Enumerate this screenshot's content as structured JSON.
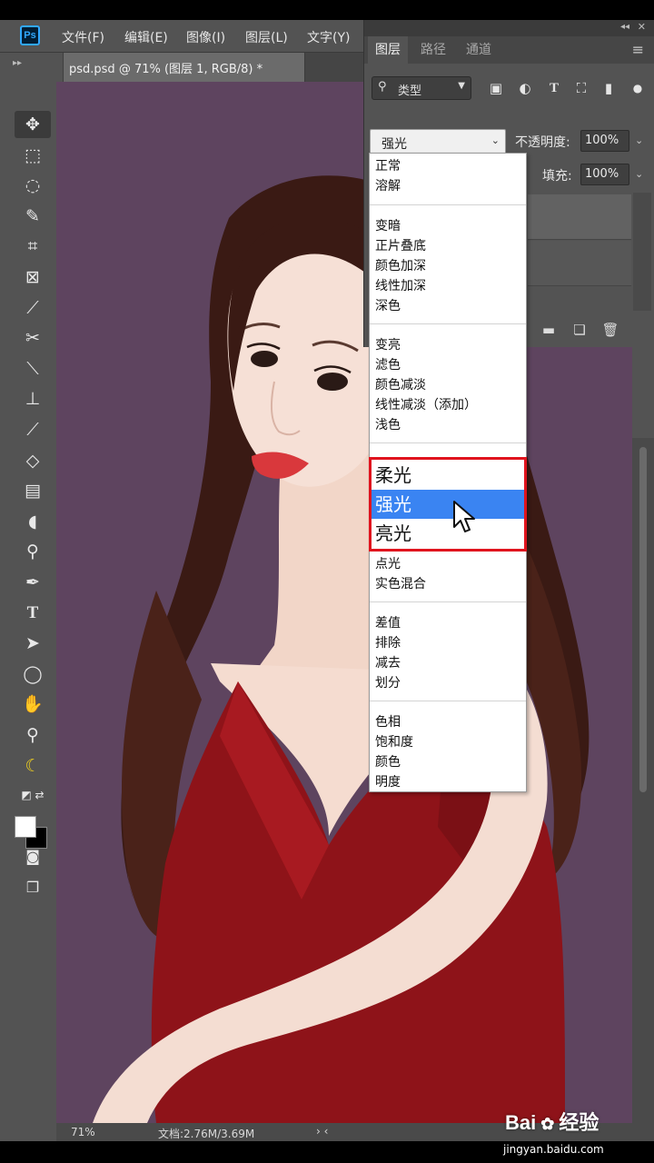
{
  "menubar": {
    "app_logo": "Ps",
    "items": [
      "文件(F)",
      "编辑(E)",
      "图像(I)",
      "图层(L)",
      "文字(Y)"
    ]
  },
  "document": {
    "tab_title": "psd.psd @ 71% (图层 1, RGB/8) *"
  },
  "status": {
    "zoom": "71%",
    "doc_size": "文档:2.76M/3.69M"
  },
  "layers_panel": {
    "tabs": [
      "图层",
      "路径",
      "通道"
    ],
    "filter_label": "类型",
    "blend_mode": "强光",
    "opacity_label": "不透明度:",
    "opacity_value": "100%",
    "fill_label": "填充:",
    "fill_value": "100%"
  },
  "blend_menu": {
    "groups": [
      [
        "正常",
        "溶解"
      ],
      [
        "变暗",
        "正片叠底",
        "颜色加深",
        "线性加深",
        "深色"
      ],
      [
        "变亮",
        "滤色",
        "颜色减淡",
        "线性减淡（添加）",
        "浅色"
      ],
      [
        "柔光",
        "强光",
        "亮光"
      ],
      [
        "点光",
        "实色混合"
      ],
      [
        "差值",
        "排除",
        "减去",
        "划分"
      ],
      [
        "色相",
        "饱和度",
        "颜色",
        "明度"
      ]
    ],
    "selected": "强光"
  },
  "watermark": {
    "brand": "Bai",
    "brand_suffix": "经验",
    "url": "jingyan.baidu.com"
  },
  "colors": {
    "canvas_bg": "#5e445f",
    "ui_bg": "#535353",
    "selection": "#3a84f2",
    "highlight_box": "#e0141e",
    "ps_blue": "#31a8ff"
  }
}
